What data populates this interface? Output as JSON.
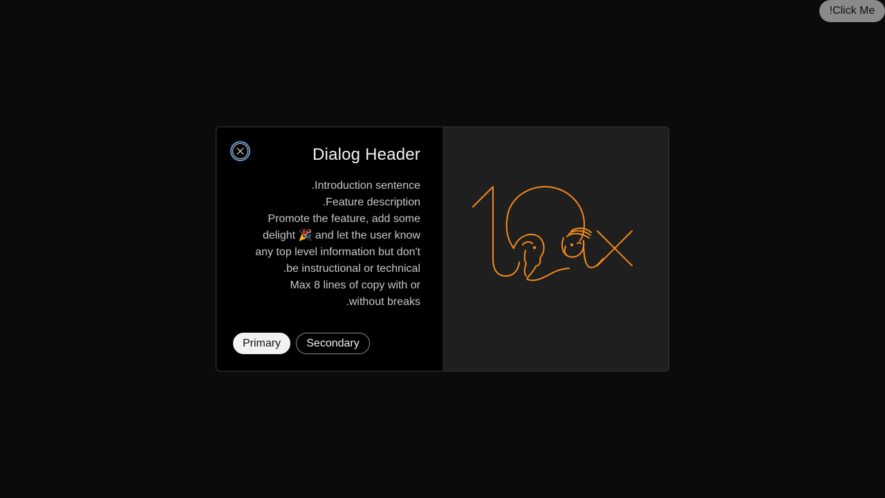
{
  "trigger": {
    "label": "!Click Me"
  },
  "dialog": {
    "title": "Dialog Header",
    "body_lines": [
      ".Introduction sentence",
      ".Feature description",
      "Promote the feature, add some",
      "delight 🎉 and let the user know",
      "any top level information but don't",
      ".be instructional or technical",
      "Max 8 lines of copy with or",
      ".without breaks"
    ],
    "primary_label": "Primary",
    "secondary_label": "Secondary",
    "close_icon": "close-icon",
    "illustration_icon": "10x-illustration-icon"
  },
  "colors": {
    "page_bg": "#0b0b0b",
    "content_bg": "#000000",
    "media_bg": "#1f1f1f",
    "accent_orange": "#f28a1c",
    "focus_ring": "#5b9bd5"
  }
}
